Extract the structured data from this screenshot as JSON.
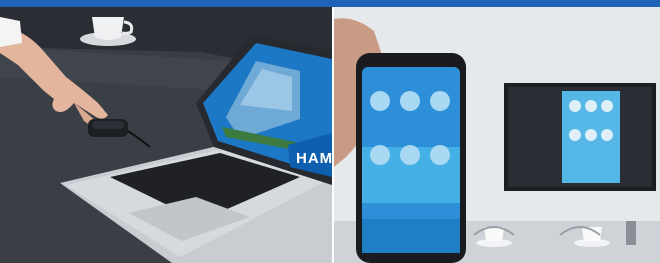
{
  "photos": [
    {
      "id": "left",
      "screen_text": "HAM",
      "colors": {
        "accent": "#1f63b8",
        "laptop_screen": "#1c78c4",
        "desk": "#3a3e45"
      }
    },
    {
      "id": "right",
      "colors": {
        "phone_screen": "#2d8fd8",
        "tv_screen": "#55b7e6"
      }
    }
  ],
  "header": {
    "accent_color": "#1f63b8"
  }
}
